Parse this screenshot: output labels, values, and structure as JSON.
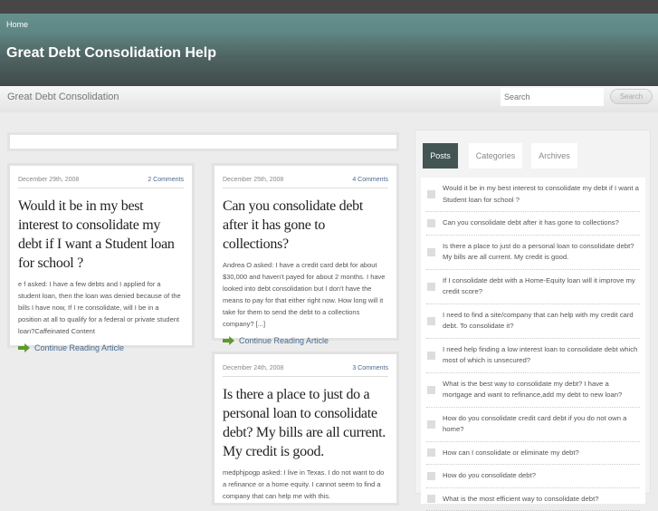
{
  "nav": {
    "home": "Home"
  },
  "site": {
    "title": "Great Debt Consolidation Help",
    "tagline": "Great Debt Consolidation"
  },
  "search": {
    "placeholder": "Search",
    "button": "Search"
  },
  "posts": [
    {
      "date": "December 29th, 2008",
      "comments": "2 Comments",
      "title": "Would it be in my best interest to consolidate my debt if I want a Student loan for school ?",
      "excerpt": "e f asked: I have a few debts and I applied for a student loan, then the loan was denied because of the bills I have now, If I re consolidate, will I be in a position at all to qualify for a federal or private student loan?Caffeinated Content",
      "more": "Continue Reading Article"
    },
    {
      "date": "December 25th, 2008",
      "comments": "4 Comments",
      "title": "Can you consolidate debt after it has gone to collections?",
      "excerpt": "Andrea O asked: I have a credit card debt for about $30,000 and haven't payed for about 2 months. I have looked into debt consolidation but I don't have the means to pay for that either right now. How long will it take for them to send the debt to a collections company? [...]",
      "more": "Continue Reading Article"
    },
    {
      "date": "December 24th, 2008",
      "comments": "3 Comments",
      "title": "Is there a place to just do a personal loan to consolidate debt? My bills are all current. My credit is good.",
      "excerpt": "medphjpogp asked: I live in Texas. I do not want to do a refinance or a home equity. I cannot seem to find a company that can help me with this."
    }
  ],
  "sidebar": {
    "tabs": [
      "Posts",
      "Categories",
      "Archives"
    ],
    "items": [
      "Would it be in my best interest to consolidate my debt if I want a Student loan for school ?",
      "Can you consolidate debt after it has gone to collections?",
      "Is there a place to just do a personal loan to consolidate debt? My bills are all current. My credit is good.",
      "If I consolidate debt with a Home-Equity loan will it improve my credit score?",
      "I need to find a site/company that can help with my credit card debt. To consolidate it?",
      "I need help finding a low interest loan to consolidate debt which most of which is unsecured?",
      "What is the best way to consolidate my debt? I have a mortgage and want to refinance,add my debt to new loan?",
      "How do you consolidate credit card debt if you do not own a home?",
      "How can I consolidate or eliminate my debt?",
      "How do you consolidate debt?",
      "What is the most efficient way to consolidate debt?"
    ]
  }
}
